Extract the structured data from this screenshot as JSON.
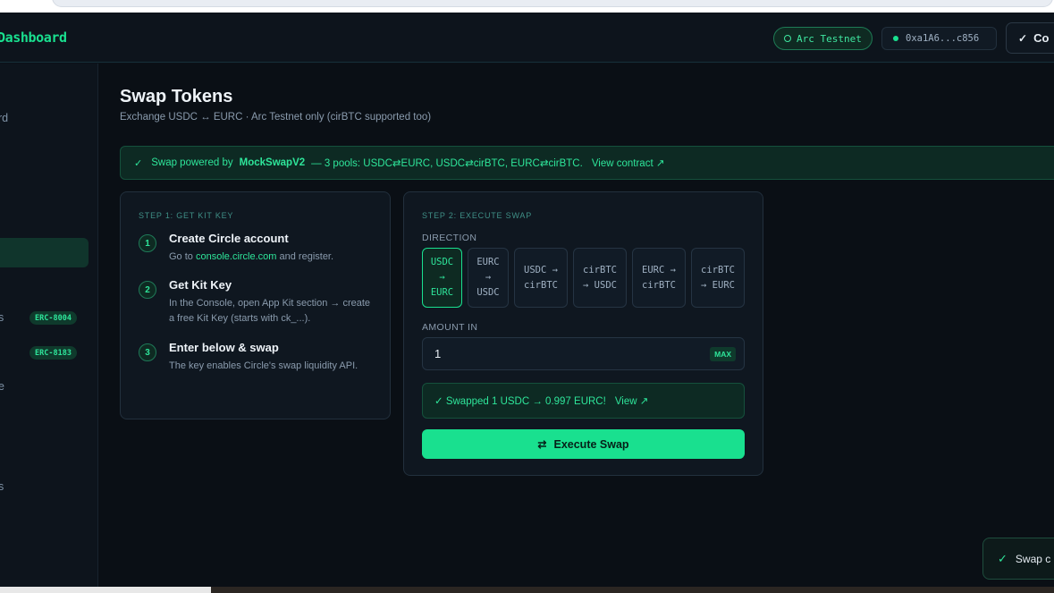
{
  "header": {
    "brand": "Dashboard",
    "network": "Arc Testnet",
    "address": "0xa1A6...c856",
    "connect_label": "Co"
  },
  "sidebar": {
    "items": [
      {
        "label": "rd"
      },
      {
        "label": "s",
        "badge": "ERC-8004"
      },
      {
        "label": "",
        "badge": "ERC-8183"
      },
      {
        "label": "e"
      },
      {
        "label": "s"
      }
    ]
  },
  "page": {
    "title": "Swap Tokens",
    "subtitle": "Exchange USDC ↔ EURC · Arc Testnet only (cirBTC supported too)"
  },
  "banner": {
    "prefix": "Swap powered by",
    "contract": "MockSwapV2",
    "pools": "— 3 pools: USDC⇄EURC, USDC⇄cirBTC, EURC⇄cirBTC.",
    "link": "View contract ↗"
  },
  "step1": {
    "heading": "STEP 1: GET KIT KEY",
    "items": [
      {
        "num": "1",
        "title": "Create Circle account",
        "desc_pre": "Go to ",
        "desc_link": "console.circle.com",
        "desc_post": " and register."
      },
      {
        "num": "2",
        "title": "Get Kit Key",
        "desc": "In the Console, open App Kit section → create a free Kit Key (starts with ck_...)."
      },
      {
        "num": "3",
        "title": "Enter below & swap",
        "desc": "The key enables Circle's swap liquidity API."
      }
    ]
  },
  "step2": {
    "heading": "STEP 2: EXECUTE SWAP",
    "direction_label": "DIRECTION",
    "directions": [
      {
        "from": "USDC",
        "arrow": "→",
        "to": "EURC",
        "active": true
      },
      {
        "from": "EURC",
        "arrow": "→",
        "to": "USDC",
        "active": false
      },
      {
        "from": "USDC →",
        "arrow": "",
        "to": "cirBTC",
        "active": false
      },
      {
        "from": "cirBTC",
        "arrow": "",
        "to": "→ USDC",
        "active": false
      },
      {
        "from": "EURC →",
        "arrow": "",
        "to": "cirBTC",
        "active": false
      },
      {
        "from": "cirBTC",
        "arrow": "",
        "to": "→ EURC",
        "active": false
      }
    ],
    "amount_label": "AMOUNT IN",
    "amount_value": "1",
    "max_label": "MAX",
    "success_text": "✓ Swapped 1 USDC → 0.997 EURC!",
    "success_link": "View ↗",
    "execute_label": "Execute Swap"
  },
  "toast": {
    "text": "Swap c"
  },
  "colors": {
    "accent": "#19e08f",
    "background": "#0a0f15",
    "card": "#0f1720"
  }
}
